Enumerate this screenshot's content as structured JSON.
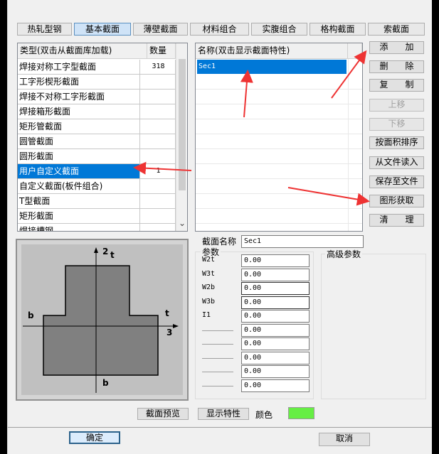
{
  "tabs": [
    "热轧型钢",
    "基本截面",
    "薄壁截面",
    "材料组合",
    "实腹组合",
    "格构截面",
    "索截面"
  ],
  "left_table": {
    "headers": [
      "类型(双击从截面库加载)",
      "数量"
    ],
    "rows": [
      {
        "name": "焊接对称工字型截面",
        "count": "318"
      },
      {
        "name": "工字形楔形截面",
        "count": ""
      },
      {
        "name": "焊接不对称工字形截面",
        "count": ""
      },
      {
        "name": "焊接箱形截面",
        "count": ""
      },
      {
        "name": "矩形管截面",
        "count": ""
      },
      {
        "name": "圆管截面",
        "count": ""
      },
      {
        "name": "圆形截面",
        "count": ""
      },
      {
        "name": "用户自定义截面",
        "count": "1"
      },
      {
        "name": "自定义截面(板件组合)",
        "count": ""
      },
      {
        "name": "T型截面",
        "count": ""
      },
      {
        "name": "矩形截面",
        "count": ""
      },
      {
        "name": "焊接槽钢",
        "count": ""
      }
    ],
    "scroll_down_glyph": "⌄"
  },
  "name_list": {
    "header": "名称(双击显示截面特性)",
    "items": [
      "Sec1"
    ]
  },
  "side_buttons": [
    {
      "label": "添　　加",
      "enabled": true
    },
    {
      "label": "删　　除",
      "enabled": true
    },
    {
      "label": "复　　制",
      "enabled": true
    },
    {
      "label": "上移",
      "enabled": false
    },
    {
      "label": "下移",
      "enabled": false
    },
    {
      "label": "按面积排序",
      "enabled": true
    },
    {
      "label": "从文件读入",
      "enabled": true
    },
    {
      "label": "保存至文件",
      "enabled": true
    },
    {
      "label": "图形获取",
      "enabled": true
    },
    {
      "label": "清　　理",
      "enabled": true
    }
  ],
  "preview": {
    "labels": {
      "axis2": "2",
      "t_top": "t",
      "b_left": "b",
      "t_right": "t",
      "axis3": "3",
      "b_bottom": "b"
    }
  },
  "section_name": {
    "label": "截面名称",
    "value": "Sec1"
  },
  "params": {
    "title": "参数",
    "rows": [
      {
        "label": "W2t",
        "value": "0.00"
      },
      {
        "label": "W3t",
        "value": "0.00"
      },
      {
        "label": "W2b",
        "value": "0.00"
      },
      {
        "label": "W3b",
        "value": "0.00"
      },
      {
        "label": "I1",
        "value": "0.00"
      },
      {
        "label": "",
        "value": "0.00"
      },
      {
        "label": "",
        "value": "0.00"
      },
      {
        "label": "",
        "value": "0.00"
      },
      {
        "label": "",
        "value": "0.00"
      },
      {
        "label": "",
        "value": "0.00"
      }
    ]
  },
  "advanced": {
    "title": "高级参数"
  },
  "bottom": {
    "preview_btn": "截面预览",
    "props_btn": "显示特性",
    "color_label": "颜色",
    "color_value": "#66ee44",
    "ok": "确定",
    "cancel": "取消"
  },
  "colors": {
    "selection": "#0078d7",
    "arrow": "#ee3333",
    "preview_bg": "#c0c0c0",
    "shape_fill": "#808080"
  }
}
